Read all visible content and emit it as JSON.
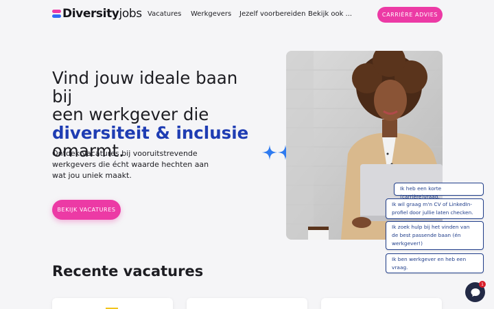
{
  "header": {
    "logo_bold": "Diversity",
    "logo_light": "jobs",
    "nav": [
      "Vacatures",
      "Werkgevers",
      "Jezelf voorbereiden",
      "Bekijk ook ..."
    ],
    "cta": "CARRIÈRE ADVIES"
  },
  "hero": {
    "title_line1": "Vind jouw ideale baan bij",
    "title_line2": "een werkgever die",
    "title_accent": "diversiteit & inclusie",
    "title_line4": "omarmt.",
    "subtitle": "Ontdek vacatures bij vooruitstrevende werkgevers die écht waarde hechten aan wat jou uniek maakt.",
    "cta": "BEKIJK VACATURES"
  },
  "recent": {
    "title": "Recente vacatures"
  },
  "chat": {
    "options": [
      "Ik heb een korte (carrière)vraag.",
      "Ik wil graag m'n CV of LinkedIn-profiel door jullie laten checken.",
      "Ik zoek hulp bij het vinden van de best passende baan (én werkgever!)",
      "Ik ben werkgever en heb een vraag."
    ],
    "badge": "1"
  },
  "colors": {
    "accent_pink": "#ec3aa5",
    "accent_blue": "#1f3db3",
    "sparkle_blue": "#2f7bf0",
    "chat_dark": "#232a46",
    "badge_red": "#d81e2a"
  },
  "icons": {
    "logo_mark": "two-stacked-bars-logo",
    "sparkles": "sparkle-stars",
    "chat_launcher": "chat-bubble-icon"
  }
}
